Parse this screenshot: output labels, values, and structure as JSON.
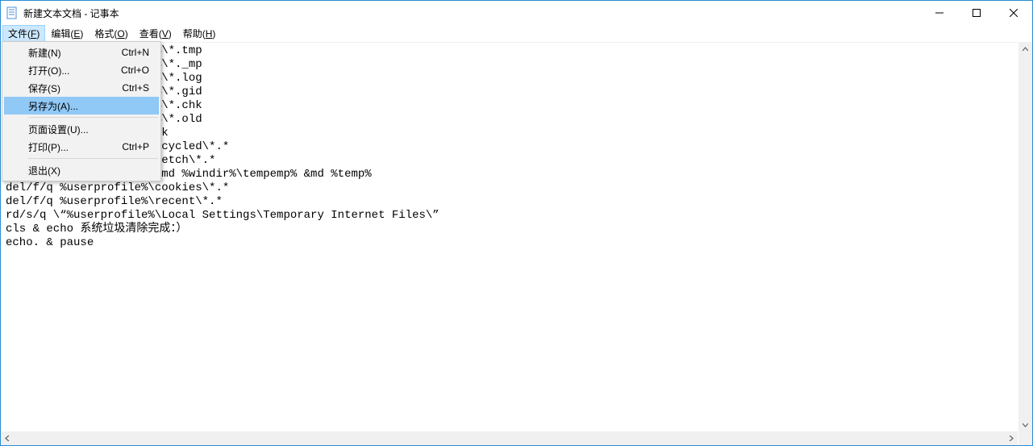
{
  "title": "新建文本文档 - 记事本",
  "menubar": {
    "file": {
      "label_pre": "文件(",
      "hotkey": "F",
      "label_post": ")"
    },
    "edit": {
      "label_pre": "编辑(",
      "hotkey": "E",
      "label_post": ")"
    },
    "format": {
      "label_pre": "格式(",
      "hotkey": "O",
      "label_post": ")"
    },
    "view": {
      "label_pre": "查看(",
      "hotkey": "V",
      "label_post": ")"
    },
    "help": {
      "label_pre": "帮助(",
      "hotkey": "H",
      "label_post": ")"
    }
  },
  "file_menu": {
    "new": {
      "label": "新建(N)",
      "accel": "Ctrl+N"
    },
    "open": {
      "label": "打开(O)...",
      "accel": "Ctrl+O"
    },
    "save": {
      "label": "保存(S)",
      "accel": "Ctrl+S"
    },
    "saveas": {
      "label": "另存为(A)...",
      "accel": ""
    },
    "pagesetup": {
      "label": "页面设置(U)...",
      "accel": ""
    },
    "print": {
      "label": "打印(P)...",
      "accel": "Ctrl+P"
    },
    "exit": {
      "label": "退出(X)",
      "accel": ""
    }
  },
  "editor_text": "del/f/s/q %systemdrive%\\*.tmp\ndel/f/s/q %systemdrive%\\*._mp\ndel/f/s/q %systemdrive%\\*.log\ndel/f/s/q %systemdrive%\\*.gid\ndel/f/s/q %systemdrive%\\*.chk\ndel/f/s/q %systemdrive%\\*.old\ndel/f/s/q %windir%\\*.bak\ndel/f/s/q %windir%\\*\\recycled\\*.*\ndel/f/s/q %windir%\\prefetch\\*.*\nrd/s/q %windir%\\temp & md %windir%\\tempemp% &md %temp%\ndel/f/q %userprofile%\\cookies\\*.*\ndel/f/q %userprofile%\\recent\\*.*\nrd/s/q \\“%userprofile%\\Local Settings\\Temporary Internet Files\\”\ncls & echo 系统垃圾清除完成：）\necho. & pause"
}
